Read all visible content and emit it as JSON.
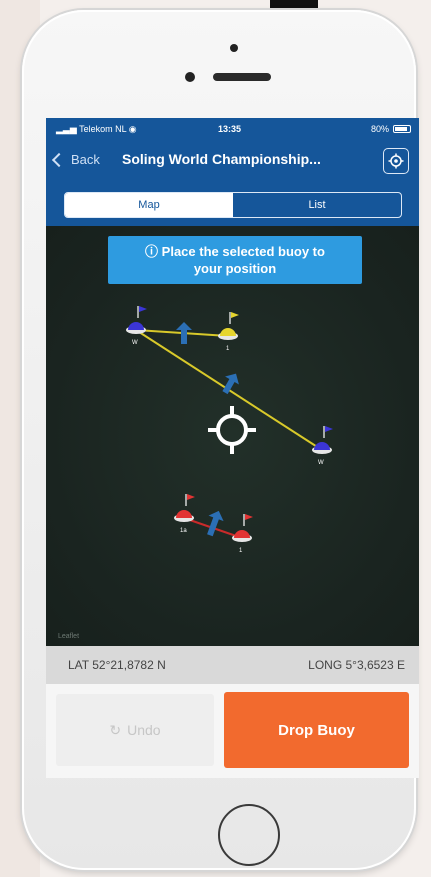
{
  "status_bar": {
    "carrier": "Telekom NL",
    "time": "13:35",
    "battery": "80%"
  },
  "nav": {
    "back_label": "Back",
    "title": "Soling World Championship...",
    "right_icon": "locate-icon"
  },
  "tabs": [
    {
      "label": "Map",
      "active": true
    },
    {
      "label": "List",
      "active": false
    }
  ],
  "map": {
    "banner_icon": "info-icon",
    "banner_line1": "Place the selected buoy to",
    "banner_line2": "your position",
    "credit": "Leaflet",
    "buoys": [
      {
        "color": "#3b35d6",
        "label": "W"
      },
      {
        "color": "#e6d52e",
        "label": "1"
      },
      {
        "color": "#3b35d6",
        "label": "W"
      },
      {
        "color": "#e23434",
        "label": "1a"
      },
      {
        "color": "#e23434",
        "label": "1"
      }
    ]
  },
  "coords": {
    "lat": "LAT 52°21,8782 N",
    "long": "LONG 5°3,6523 E"
  },
  "actions": {
    "undo_label": "Undo",
    "drop_label": "Drop Buoy"
  },
  "colors": {
    "nav_blue": "#15569a",
    "banner_blue": "#2e9be0",
    "drop_orange": "#f26a2e",
    "map_bg": "#1b2521"
  }
}
